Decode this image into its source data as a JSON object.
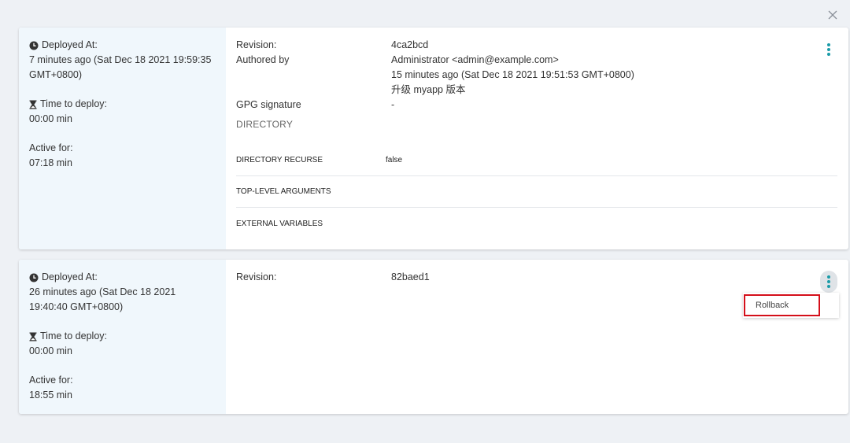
{
  "colors": {
    "accent": "#1a9ba8",
    "highlight": "#d40f1a",
    "panel": "#f0f7fc"
  },
  "icons": {
    "close": "close-icon",
    "clock": "clock-icon",
    "hourglass": "hourglass-icon",
    "more": "more-vert-icon"
  },
  "deployments": [
    {
      "deployed_at_label": "Deployed At:",
      "deployed_at_value": "7 minutes ago (Sat Dec 18 2021 19:59:35 GMT+0800)",
      "time_to_deploy_label": "Time to deploy:",
      "time_to_deploy_value": "00:00 min",
      "active_for_label": "Active for:",
      "active_for_value": "07:18 min",
      "revision_label": "Revision:",
      "revision_value": "4ca2bcd",
      "authored_by_label": "Authored by",
      "author": "Administrator <admin@example.com>",
      "authored_time": "15 minutes ago (Sat Dec 18 2021 19:51:53 GMT+0800)",
      "commit_message": "升级 myapp 版本",
      "gpg_label": "GPG signature",
      "gpg_value": "-",
      "section_title": "DIRECTORY",
      "directory_rows": [
        {
          "key": "DIRECTORY RECURSE",
          "value": "false"
        },
        {
          "key": "TOP-LEVEL ARGUMENTS",
          "value": ""
        },
        {
          "key": "EXTERNAL VARIABLES",
          "value": ""
        }
      ]
    },
    {
      "deployed_at_label": "Deployed At:",
      "deployed_at_value": "26 minutes ago (Sat Dec 18 2021 19:40:40 GMT+0800)",
      "time_to_deploy_label": "Time to deploy:",
      "time_to_deploy_value": "00:00 min",
      "active_for_label": "Active for:",
      "active_for_value": "18:55 min",
      "revision_label": "Revision:",
      "revision_value": "82baed1",
      "menu_item": "Rollback"
    }
  ]
}
